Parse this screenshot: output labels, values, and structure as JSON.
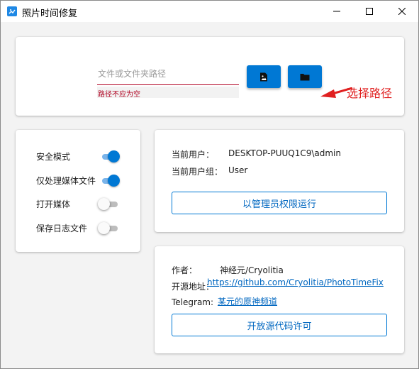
{
  "window": {
    "title": "照片时间修复",
    "icon": "photo-fix-app-icon",
    "controls": [
      "minimize-icon",
      "maximize-icon",
      "close-icon"
    ]
  },
  "path_section": {
    "input_placeholder": "文件或文件夹路径",
    "input_value": "",
    "error_text": "路径不应为空",
    "file_button_icon": "image-file-icon",
    "folder_button_icon": "folder-icon",
    "annotation_text": "选择路径",
    "annotation_color": "#e02020"
  },
  "options": [
    {
      "label": "安全模式",
      "on": true
    },
    {
      "label": "仅处理媒体文件",
      "on": true
    },
    {
      "label": "打开媒体",
      "on": false
    },
    {
      "label": "保存日志文件",
      "on": false
    }
  ],
  "user_info": {
    "user_label": "当前用户：",
    "user_value": "DESKTOP-PUUQ1C9\\admin",
    "group_label": "当前用户组：",
    "group_value": "User",
    "admin_button": "以管理员权限运行"
  },
  "about": {
    "author_label": "作者：",
    "author_value": "神经元/Cryolitia",
    "repo_label": "开源地址：",
    "repo_link": "https://github.com/Cryolitia/PhotoTimeFix",
    "telegram_label": "Telegram:",
    "telegram_link": "某元的原神频道",
    "license_button": "开放源代码许可"
  },
  "colors": {
    "accent": "#0078d4",
    "error": "#b00020",
    "link": "#0067c0"
  }
}
